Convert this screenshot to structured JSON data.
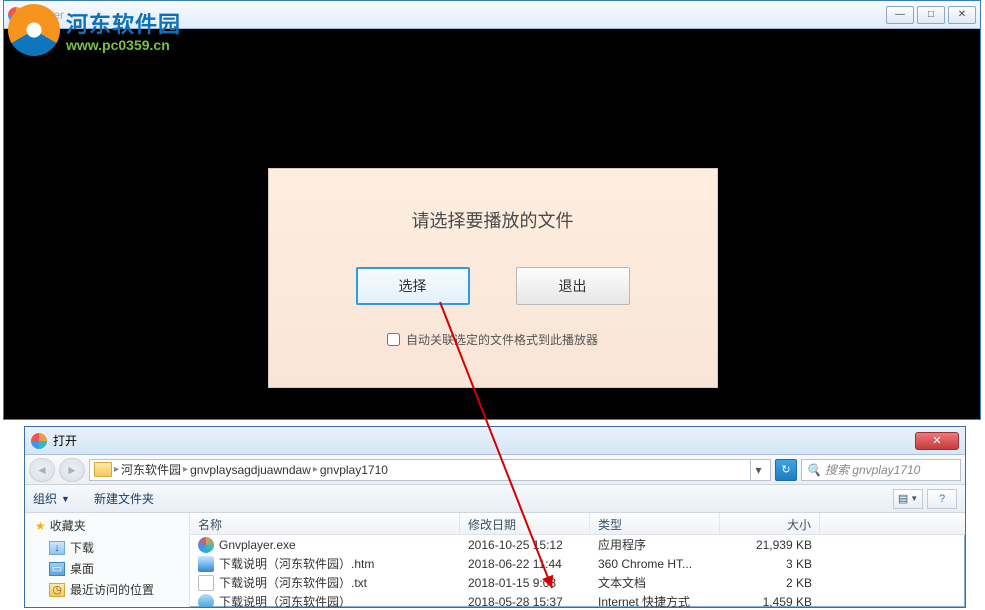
{
  "player": {
    "title": "Player"
  },
  "watermark": {
    "site_name": "河东软件园",
    "url": "www.pc0359.cn"
  },
  "dialog": {
    "message": "请选择要播放的文件",
    "select_label": "选择",
    "exit_label": "退出",
    "checkbox_label": "自动关联选定的文件格式到此播放器"
  },
  "filedlg": {
    "title": "打开",
    "breadcrumbs": [
      "河东软件园",
      "gnvplaysagdjuawndaw",
      "gnvplay1710"
    ],
    "search_placeholder": "搜索 gnvplay1710",
    "toolbar": {
      "organize": "组织",
      "new_folder": "新建文件夹"
    },
    "sidebar": {
      "header": "收藏夹",
      "items": [
        "下载",
        "桌面",
        "最近访问的位置"
      ]
    },
    "columns": {
      "name": "名称",
      "date": "修改日期",
      "type": "类型",
      "size": "大小"
    },
    "rows": [
      {
        "icon": "exe",
        "name": "Gnvplayer.exe",
        "date": "2016-10-25 15:12",
        "type": "应用程序",
        "size": "21,939 KB"
      },
      {
        "icon": "htm",
        "name": "下载说明（河东软件园）.htm",
        "date": "2018-06-22 11:44",
        "type": "360 Chrome HT...",
        "size": "3 KB"
      },
      {
        "icon": "txt",
        "name": "下载说明（河东软件园）.txt",
        "date": "2018-01-15 9:08",
        "type": "文本文档",
        "size": "2 KB"
      },
      {
        "icon": "url",
        "name": "下载说明（河东软件园）",
        "date": "2018-05-28 15:37",
        "type": "Internet 快捷方式",
        "size": "1,459 KB"
      }
    ]
  }
}
